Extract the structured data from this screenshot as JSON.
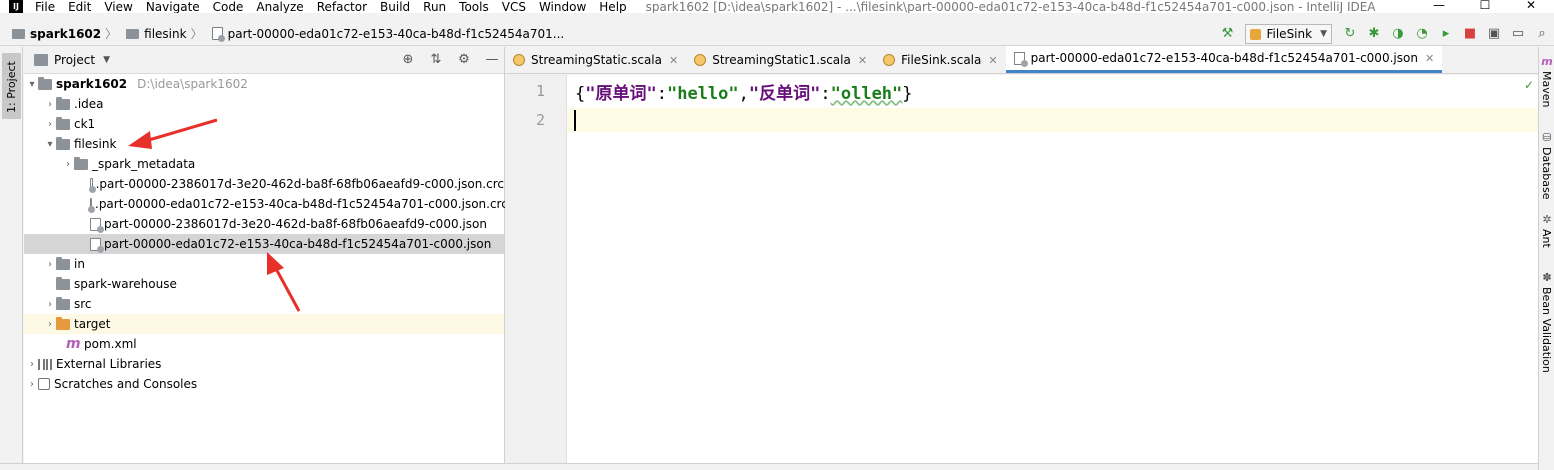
{
  "menubar": {
    "items": [
      "File",
      "Edit",
      "View",
      "Navigate",
      "Code",
      "Analyze",
      "Refactor",
      "Build",
      "Run",
      "Tools",
      "VCS",
      "Window",
      "Help"
    ],
    "window_title": "spark1602 [D:\\idea\\spark1602] - ...\\filesink\\part-00000-eda01c72-e153-40ca-b48d-f1c52454a701-c000.json - IntelliJ IDEA",
    "min": "—",
    "max": "☐",
    "close": "✕"
  },
  "navbar": {
    "crumbs": [
      "spark1602",
      "filesink",
      "part-00000-eda01c72-e153-40ca-b48d-f1c52454a701..."
    ],
    "run_config": "FileSink"
  },
  "left_strip": {
    "tab": "1: Project"
  },
  "project_panel": {
    "title": "Project",
    "tree": [
      {
        "label": "spark1602",
        "hint": "D:\\idea\\spark1602"
      },
      {
        "label": ".idea"
      },
      {
        "label": "ck1"
      },
      {
        "label": "filesink"
      },
      {
        "label": "_spark_metadata"
      },
      {
        "label": ".part-00000-2386017d-3e20-462d-ba8f-68fb06aeafd9-c000.json.crc"
      },
      {
        "label": ".part-00000-eda01c72-e153-40ca-b48d-f1c52454a701-c000.json.crc"
      },
      {
        "label": "part-00000-2386017d-3e20-462d-ba8f-68fb06aeafd9-c000.json"
      },
      {
        "label": "part-00000-eda01c72-e153-40ca-b48d-f1c52454a701-c000.json"
      },
      {
        "label": "in"
      },
      {
        "label": "spark-warehouse"
      },
      {
        "label": "src"
      },
      {
        "label": "target"
      },
      {
        "label": "pom.xml"
      },
      {
        "label": "External Libraries"
      },
      {
        "label": "Scratches and Consoles"
      }
    ]
  },
  "editor": {
    "tabs": [
      {
        "label": "StreamingStatic.scala"
      },
      {
        "label": "StreamingStatic1.scala"
      },
      {
        "label": "FileSink.scala"
      },
      {
        "label": "part-00000-eda01c72-e153-40ca-b48d-f1c52454a701-c000.json"
      }
    ],
    "line_numbers": [
      "1",
      "2"
    ],
    "code": {
      "open_brace": "{",
      "key1": "\"原单词\"",
      "colon1": ":",
      "val1": "\"hello\"",
      "comma": ",",
      "key2": "\"反单词\"",
      "colon2": ":",
      "val2": "\"olleh\"",
      "close_brace": "}"
    }
  },
  "right_strip": {
    "items": [
      "Maven",
      "Database",
      "Ant",
      "Bean Validation"
    ]
  },
  "colors": {
    "selection": "#d5d5d5",
    "accent_tab": "#4083c9",
    "json_key": "#660e7a",
    "json_value": "#1a7d1a",
    "annotation_arrow": "#e8302a"
  }
}
